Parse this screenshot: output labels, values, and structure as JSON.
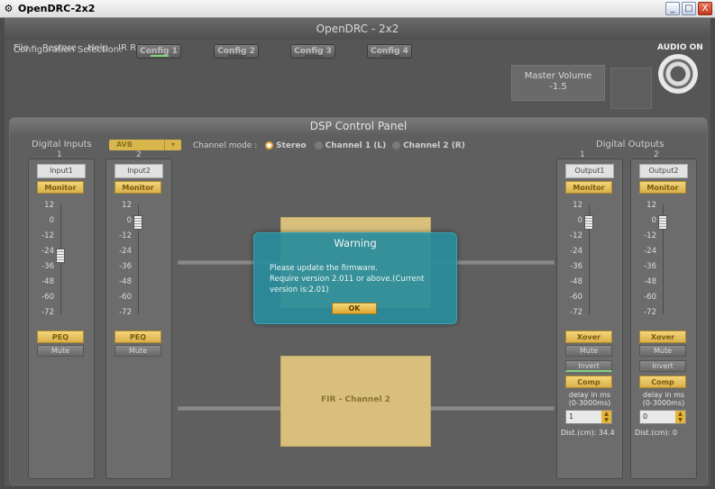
{
  "window": {
    "title": "OpenDRC-2x2",
    "minimize": "_",
    "maximize": "□",
    "close": "X"
  },
  "app": {
    "title": "OpenDRC - 2x2"
  },
  "menu": [
    {
      "label": "File"
    },
    {
      "label": "Restore"
    },
    {
      "label": "Help"
    },
    {
      "label": "IR Remote"
    }
  ],
  "config": {
    "label": "Configuration Selection:",
    "buttons": [
      {
        "label": "Config 1"
      },
      {
        "label": "Config 2"
      },
      {
        "label": "Config 3"
      },
      {
        "label": "Config 4"
      }
    ],
    "active_index": 0
  },
  "master_volume": {
    "label": "Master Volume",
    "value": "-1.5"
  },
  "audio": {
    "label": "AUDIO ON"
  },
  "dsp": {
    "title": "DSP Control Panel",
    "digital_inputs_label": "Digital Inputs",
    "input_select_value": "AVB",
    "channel_mode": {
      "label": "Channel mode :",
      "options": [
        "Stereo",
        "Channel 1 (L)",
        "Channel 2 (R)"
      ],
      "selected": "Stereo"
    },
    "digital_outputs_label": "Digital Outputs",
    "fir_label": "FIR - Channel 2",
    "scale": [
      "12",
      "0",
      "-12",
      "-24",
      "-36",
      "-48",
      "-60",
      "-72"
    ],
    "inputs": [
      {
        "num": "1",
        "name": "Input1",
        "monitor": "Monitor",
        "peq": "PEQ",
        "mute": "Mute",
        "fader_db": -30
      },
      {
        "num": "2",
        "name": "Input2",
        "monitor": "Monitor",
        "peq": "PEQ",
        "mute": "Mute",
        "fader_db": 0
      }
    ],
    "outputs": [
      {
        "num": "1",
        "name": "Output1",
        "monitor": "Monitor",
        "xover": "Xover",
        "mute": "Mute",
        "invert": "Invert",
        "comp": "Comp",
        "delay_label_1": "delay in ms",
        "delay_label_2": "(0-3000ms)",
        "delay_value": "1",
        "dist": "Dist.(cm): 34.4",
        "fader_db": 0
      },
      {
        "num": "2",
        "name": "Output2",
        "monitor": "Monitor",
        "xover": "Xover",
        "mute": "Mute",
        "invert": "Invert",
        "comp": "Comp",
        "delay_label_1": "delay in ms",
        "delay_label_2": "(0-3000ms)",
        "delay_value": "0",
        "dist": "Dist.(cm): 0",
        "fader_db": 0
      }
    ]
  },
  "dialog": {
    "title": "Warning",
    "line1": "Please update the firmware.",
    "line2": "Require version 2.011 or above.(Current",
    "line3": "version is:2.01)",
    "ok": "OK"
  }
}
